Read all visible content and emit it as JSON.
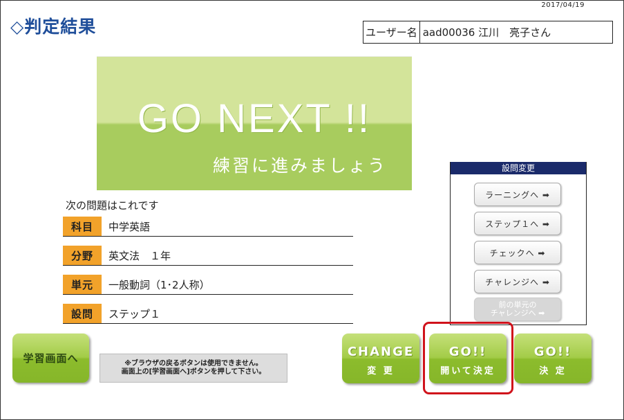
{
  "date": "2017/04/19",
  "page_title": "◇判定結果",
  "user": {
    "label": "ユーザー名",
    "value": "aad00036 江川　亮子さん"
  },
  "banner": {
    "main": "GO NEXT !!",
    "sub": "練習に進みましょう"
  },
  "next_label": "次の問題はこれです",
  "info": [
    {
      "key": "科目",
      "value": "中学英語"
    },
    {
      "key": "分野",
      "value": "英文法　１年"
    },
    {
      "key": "単元",
      "value": "一般動詞（1･2人称）"
    },
    {
      "key": "設問",
      "value": "ステップ１"
    }
  ],
  "panel": {
    "title": "設問変更",
    "buttons": [
      {
        "label": "ラーニングへ ➡",
        "enabled": true
      },
      {
        "label": "ステップ１へ ➡",
        "enabled": true
      },
      {
        "label": "チェックへ ➡",
        "enabled": true
      },
      {
        "label": "チャレンジへ ➡",
        "enabled": true
      },
      {
        "label_line1": "前の単元の",
        "label_line2": "チャレンジへ ➡",
        "enabled": false
      }
    ]
  },
  "study_button": "学習画面へ",
  "note": {
    "line1": "※ブラウザの戻るボタンは使用できません。",
    "line2": "画面上の[学習画面へ]ボタンを押して下さい。"
  },
  "actions": {
    "change": {
      "line1": "CHANGE",
      "line2": "変 更"
    },
    "go_open": {
      "line1": "GO!!",
      "line2": "開いて決定"
    },
    "go": {
      "line1": "GO!!",
      "line2": "決 定"
    }
  },
  "colors": {
    "title": "#1f4e9a",
    "accent_orange": "#f2a22a",
    "panel_header": "#1a2a6a",
    "button_green": "#8cbc2c",
    "highlight_red": "#d0121b"
  }
}
